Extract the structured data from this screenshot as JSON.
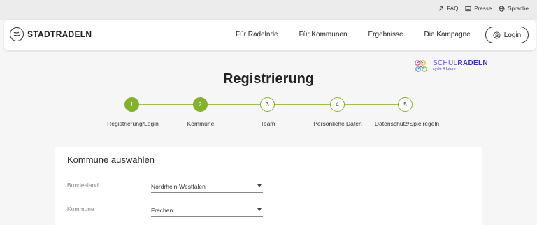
{
  "topbar": {
    "links": [
      {
        "label": "FAQ",
        "icon": "arrow-up-right-icon"
      },
      {
        "label": "Presse",
        "icon": "newspaper-icon"
      },
      {
        "label": "Sprache",
        "icon": "globe-icon"
      }
    ]
  },
  "nav": {
    "brand": "STADTRADELN",
    "items": [
      "Für Radelnde",
      "Für Kommunen",
      "Ergebnisse",
      "Die Kampagne"
    ],
    "login_label": "Login"
  },
  "schul_logo": {
    "part1": "SCHUL",
    "part2": "RADELN",
    "subtitle": "cycle 4 future"
  },
  "page": {
    "title": "Registrierung"
  },
  "steps": [
    {
      "number": "1",
      "label": "Registrierung/Login",
      "state": "done"
    },
    {
      "number": "2",
      "label": "Kommune",
      "state": "done"
    },
    {
      "number": "3",
      "label": "Team",
      "state": "open"
    },
    {
      "number": "4",
      "label": "Persönliche Daten",
      "state": "open"
    },
    {
      "number": "5",
      "label": "Datenschutz/Spielregeln",
      "state": "open"
    }
  ],
  "form": {
    "title": "Kommune auswählen",
    "fields": [
      {
        "label": "Bundesland",
        "value": "Nordrhein-Westfalen"
      },
      {
        "label": "Kommune",
        "value": "Frechen"
      }
    ]
  },
  "colors": {
    "accent": "#85b02e",
    "background": "#f6f6f6"
  }
}
